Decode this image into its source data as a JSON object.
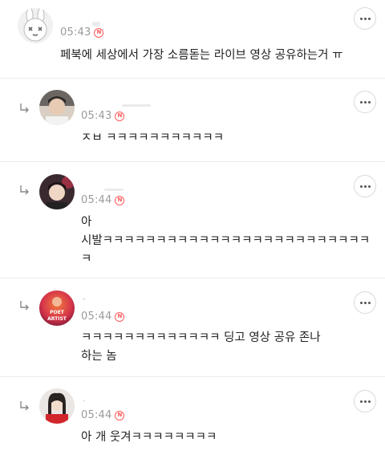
{
  "comments": [
    {
      "time": "05:43",
      "badge": "N",
      "text": "페북에 세상에서 가장 소름돋는 라이브 영상 공유하는거 ㅠ",
      "avatar": "bunny-avatar",
      "is_reply": false
    },
    {
      "time": "05:43",
      "badge": "N",
      "text": "ㅈㅂ ㅋㅋㅋㅋㅋㅋㅋㅋㅋㅋㅋ",
      "avatar": "photo-avatar",
      "is_reply": true
    },
    {
      "time": "05:44",
      "badge": "N",
      "text": "아\n시발ㅋㅋㅋㅋㅋㅋㅋㅋㅋㅋㅋㅋㅋㅋㅋㅋㅋㅋㅋㅋㅋㅋㅋㅋㅋ\nㅋ",
      "avatar": "photo-avatar",
      "is_reply": true
    },
    {
      "time": "05:44",
      "badge": "N",
      "text": "ㅋㅋㅋㅋㅋㅋㅋㅋㅋㅋㅋㅋㅋ 딩고 영상 공유 존나\n하는 놈",
      "avatar": "poet-artist-avatar",
      "avatar_text": [
        "POET",
        "ARTIST"
      ],
      "is_reply": true
    },
    {
      "time": "05:44",
      "badge": "N",
      "text": "아 개 웃겨ㅋㅋㅋㅋㅋㅋㅋㅋ",
      "avatar": "photo-avatar",
      "is_reply": true
    }
  ],
  "colors": {
    "badge": "#ff5a5a",
    "time": "#9a9a9a",
    "divider": "#ececec"
  },
  "icons": {
    "reply": "reply-arrow-icon",
    "more": "more-options-icon",
    "new": "new-badge-icon"
  }
}
